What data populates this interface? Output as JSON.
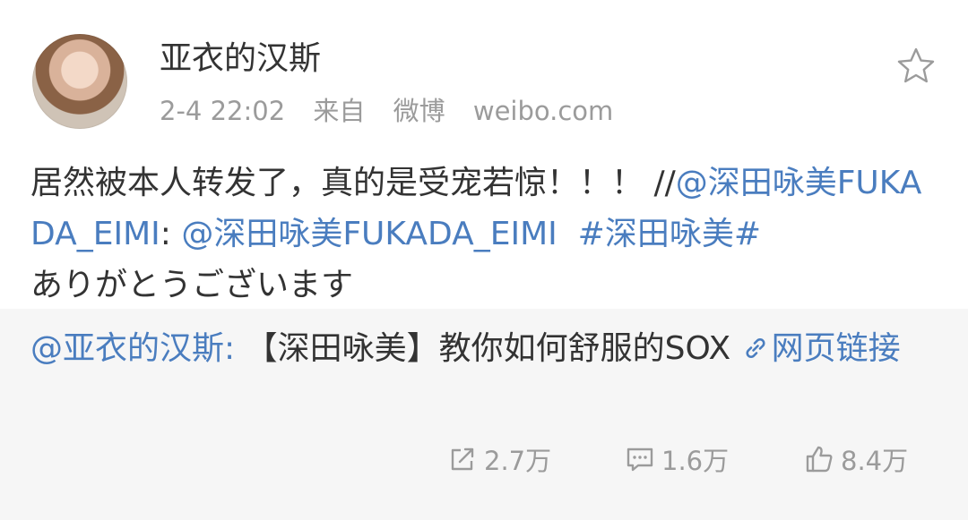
{
  "user": {
    "name": "亚衣的汉斯",
    "time": "2-4 22:02",
    "source_prefix": "来自",
    "source_app": "微博",
    "source_site": "weibo.com"
  },
  "post": {
    "text_main": "居然被本人转发了，真的是受宠若惊！！！ //",
    "mention_1": "@深田咏美FUKADA_EIMI",
    "colon_1": ": ",
    "mention_2": "@深田咏美FUKADA_EIMI",
    "hashtag": "#深田咏美#",
    "text_tail": "ありがとうございます"
  },
  "repost": {
    "author": "@亚衣的汉斯:",
    "text": "【深田咏美】教你如何舒服的SOX",
    "link_label": "网页链接"
  },
  "actions": {
    "share_count": "2.7万",
    "comment_count": "1.6万",
    "like_count": "8.4万"
  },
  "icons": {
    "favorite": "star-icon",
    "share": "share-icon",
    "comment": "comment-icon",
    "like": "thumbs-up-icon",
    "weblink": "link-icon"
  },
  "colors": {
    "link": "#4a7dbf",
    "muted": "#9b9b9b",
    "text": "#333333",
    "repost_bg": "#f6f6f6"
  }
}
